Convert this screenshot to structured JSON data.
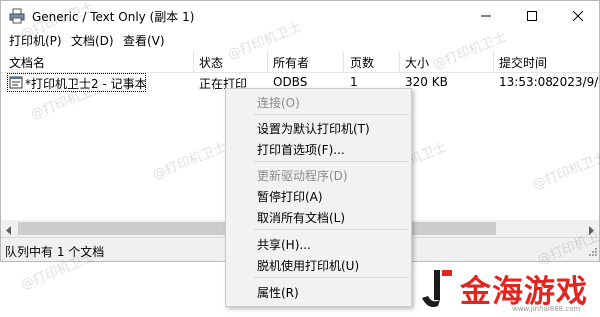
{
  "window": {
    "title": "Generic / Text Only (副本 1)",
    "menus": [
      "打印机(P)",
      "文档(D)",
      "查看(V)"
    ]
  },
  "columns": [
    "文档名",
    "状态",
    "所有者",
    "页数",
    "大小",
    "提交时间"
  ],
  "jobs": [
    {
      "name": "*打印机卫士2 - 记事本",
      "status": "正在打印",
      "owner": "ODBS",
      "pages": "1",
      "size": "320 KB",
      "time": "13:53:08",
      "date": "2023/9/"
    }
  ],
  "statusbar": {
    "text": "队列中有 1 个文档"
  },
  "context_menu": {
    "connect": "连接(O)",
    "set_default": "设置为默认打印机(T)",
    "preferences": "打印首选项(F)...",
    "update_driver": "更新驱动程序(D)",
    "pause": "暂停打印(A)",
    "cancel_all": "取消所有文档(L)",
    "share": "共享(H)...",
    "offline": "脱机使用打印机(U)",
    "properties": "属性(R)"
  },
  "watermark": {
    "text": "@打印机卫士"
  },
  "logo": {
    "text": "金海游戏",
    "sub": "www.jinhai888.com"
  },
  "colors": {
    "logo_red": "#e2261f",
    "menu_bg": "#f2f2f2",
    "disabled": "#8c8c8c"
  }
}
